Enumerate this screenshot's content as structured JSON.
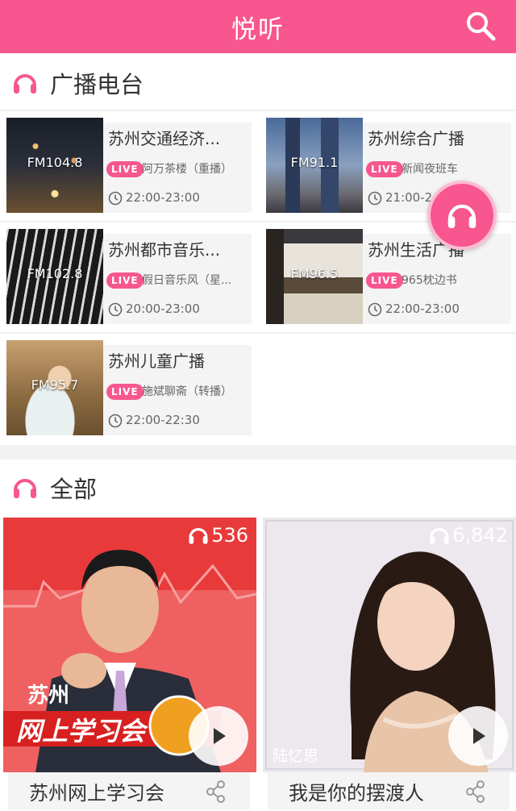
{
  "header": {
    "title": "悦听"
  },
  "sections": {
    "radio": {
      "title": "广播电台"
    },
    "all": {
      "title": "全部"
    }
  },
  "stations": [
    {
      "freq": "FM104.8",
      "name": "苏州交通经济...",
      "live": "LIVE",
      "program": "阿万茶楼（重播）",
      "time": "22:00-23:00"
    },
    {
      "freq": "FM91.1",
      "name": "苏州综合广播",
      "live": "LIVE",
      "program": "新闻夜班车",
      "time": "21:00-2"
    },
    {
      "freq": "FM102.8",
      "name": "苏州都市音乐...",
      "live": "LIVE",
      "program": "假日音乐风（星...",
      "time": "20:00-23:00"
    },
    {
      "freq": "FM96.5",
      "name": "苏州生活广播",
      "live": "LIVE",
      "program": "965枕边书",
      "time": "22:00-23:00"
    },
    {
      "freq": "FM95.7",
      "name": "苏州儿童广播",
      "live": "LIVE",
      "program": "施斌聊斋（转播）",
      "time": "22:00-22:30"
    }
  ],
  "cards": [
    {
      "count": "536",
      "title": "苏州网上学习会",
      "brand_line1": "苏州",
      "brand_line2": "网上学习会"
    },
    {
      "count": "6,842",
      "title": "我是你的摆渡人",
      "host": "陆忆思"
    }
  ],
  "colors": {
    "accent": "#f7568f"
  }
}
